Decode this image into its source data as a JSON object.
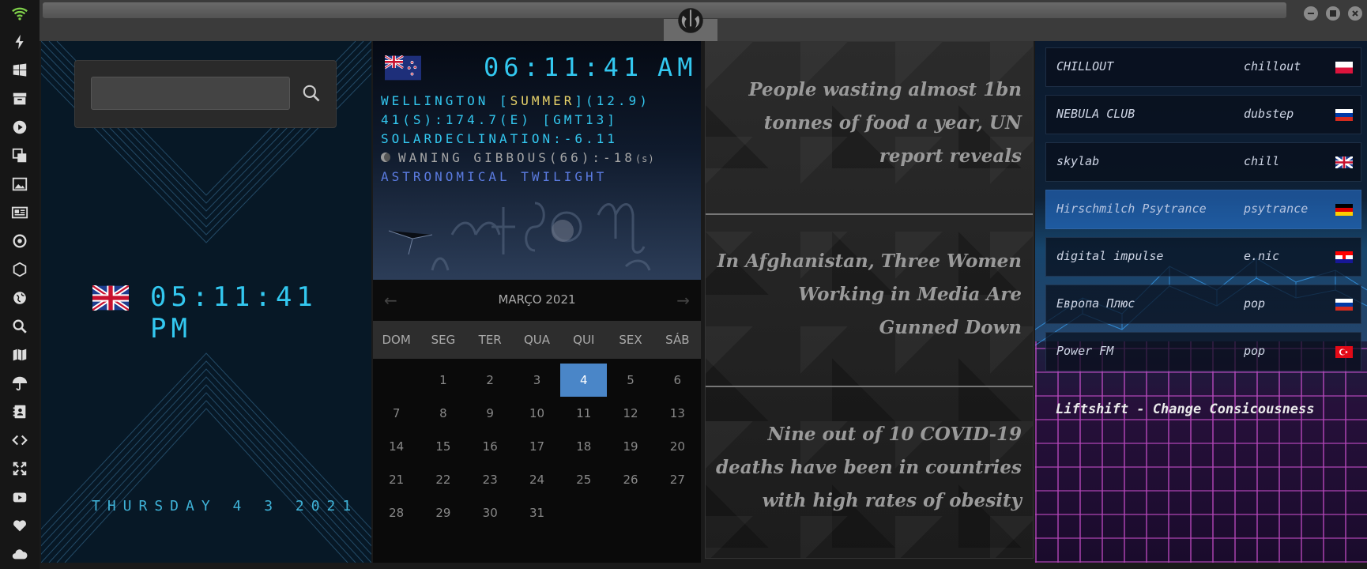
{
  "dock": {
    "icons": [
      "wifi-icon",
      "lightning-icon",
      "windows-icon",
      "archive-icon",
      "play-icon",
      "translate-icon",
      "image-icon",
      "news-icon",
      "settings-icon",
      "hexagon-icon",
      "globe-icon",
      "search-icon",
      "map-icon",
      "umbrella-icon",
      "contacts-icon",
      "code-icon",
      "fullscreen-icon",
      "youtube-icon",
      "heart-icon",
      "cloud-icon"
    ],
    "accent": "#7fd14a"
  },
  "window": {
    "logo": "rebel-alliance-logo"
  },
  "local_clock": {
    "search_placeholder": "",
    "time": "05:11:41  PM",
    "date": "THURSDAY 4 3 2021",
    "flag": "uk-flag"
  },
  "world_clock": {
    "flag": "nz-flag",
    "time": "06:11:41",
    "ampm": "AM",
    "city_prefix": "WELLINGTON [",
    "season": "SUMMER",
    "city_suffix": "](12.9)",
    "coords": "41(S):174.7(E) [GMT13]",
    "declination": "SOLARDECLINATION:-6.11",
    "moon": "WANING GIBBOUS(66):-18",
    "moon_unit": "(s)",
    "twilight": "ASTRONOMICAL TWILIGHT"
  },
  "calendar": {
    "prev": "←",
    "next": "→",
    "month": "MARÇO 2021",
    "weekdays": [
      "DOM",
      "SEG",
      "TER",
      "QUA",
      "QUI",
      "SEX",
      "SÁB"
    ],
    "weeks": [
      [
        "",
        "1",
        "2",
        "3",
        "4",
        "5",
        "6"
      ],
      [
        "7",
        "8",
        "9",
        "10",
        "11",
        "12",
        "13"
      ],
      [
        "14",
        "15",
        "16",
        "17",
        "18",
        "19",
        "20"
      ],
      [
        "21",
        "22",
        "23",
        "24",
        "25",
        "26",
        "27"
      ],
      [
        "28",
        "29",
        "30",
        "31",
        "",
        "",
        ""
      ]
    ],
    "today": "4",
    "today_color": "#4a86c8"
  },
  "news": {
    "items": [
      "People wasting almost 1bn tonnes of food a year, UN report reveals",
      "In Afghanistan, Three Women Working in Media Are Gunned Down",
      "Nine out of 10 COVID-19 deaths have been in countries with high rates of obesity"
    ]
  },
  "radio": {
    "stations": [
      {
        "name": "CHILLOUT",
        "genre": "chillout",
        "flag": "poland-flag"
      },
      {
        "name": "NEBULA CLUB",
        "genre": "dubstep",
        "flag": "russia-flag"
      },
      {
        "name": "skylab",
        "genre": "chill",
        "flag": "uk-flag"
      },
      {
        "name": "Hirschmilch Psytrance",
        "genre": "psytrance",
        "flag": "germany-flag",
        "active": true
      },
      {
        "name": "digital impulse",
        "genre": "e.nic",
        "flag": "croatia-flag"
      },
      {
        "name": "Европа Плюс",
        "genre": "pop",
        "flag": "russia-flag"
      },
      {
        "name": "Power FM",
        "genre": "pop",
        "flag": "turkey-flag"
      }
    ],
    "now_playing": "Liftshift - Change Consicousness"
  }
}
